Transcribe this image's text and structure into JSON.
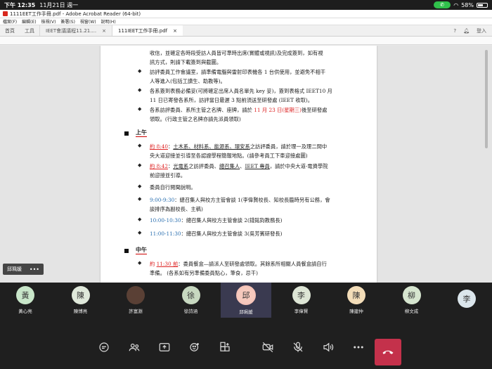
{
  "status_bar": {
    "time": "下午 12:35",
    "date": "11月21日 週一",
    "battery": "58%",
    "battery_level": 0.58
  },
  "window": {
    "title": "1111EET工作手冊.pdf - Adobe Acrobat Reader (64-bit)",
    "menu": [
      "檔案(F)",
      "編輯(E)",
      "檢視(V)",
      "簽署(S)",
      "視窗(W)",
      "說明(H)"
    ],
    "nav": [
      "首頁",
      "工具"
    ],
    "tabs": [
      {
        "label": "IEET會議議程11.21....",
        "close": "×"
      },
      {
        "label": "111IEET工作手冊.pdf",
        "close": "×"
      }
    ],
    "right_actions": {
      "help": "?",
      "login": "登入"
    }
  },
  "document": {
    "top_lines": [
      "收信，並確定各時段受訪人員皆可準時出席(實體或視訊)及完成簽到，如有視",
      "訊方式，則請下載簽到與截圖。"
    ],
    "bullets_top": [
      {
        "lines": [
          "訪評委員工作會議室，請準備電腦與雷射印表機各 1 台供使用，並避免不相干",
          "人等進入(包括工讀生、助教等)。"
        ]
      },
      {
        "lines": [
          "各系簽到表務必備妥(可將確定出席人員名單先 key 妥)，簽到表格式 IEET10 月",
          "11 日已寄發各系所，訪評當日最遲 3 點前須送至研發處 (IEET 收取)。"
        ]
      },
      {
        "pre": "各系訪評委員、系所主管之名牌、座牌，請於 ",
        "red": "11 月 23 日(星期三)",
        "post": "後至研發處",
        "line2": "領取。(行政主管之名牌亦請先派員領取)"
      }
    ],
    "section_morning": "上午",
    "morning_items": [
      {
        "time": "約 8:40",
        "sep": "：",
        "depts": "土木系、材料系、能源系、環安系",
        "rest": "之訪評委員，請於理一及理二間中",
        "line2": "央大道迎接並引導至各認證學程簡報地點。(請參考員工下車迎接處圖)"
      },
      {
        "time": "約 8:42",
        "sep": "：",
        "depts": "光電系",
        "mid": "之訪評委員、",
        "u2": "總召集人",
        "mid2": "、",
        "u3": "IEET 專員",
        "rest": "，請於中央大道-電資學院",
        "line2": "前迎接並引導。"
      },
      {
        "text": "委員自行閱聞說明。"
      },
      {
        "time": "9:00-9:30",
        "rest": "：總召集人與校方主管會談 1(李偉賢校長、知校長臨時另有公務，會",
        "line2": "談排序為副校長、主稿)"
      },
      {
        "time": "10:00-10:30",
        "rest": "：總召集人與校方主管會談 2(錢銘鈞教務長)"
      },
      {
        "time": "11:00-11:30",
        "rest": "：總召集人與校方主管會談 3(吳芳賓研發長)"
      }
    ],
    "section_noon": "中午",
    "noon_item": {
      "pre": "約 ",
      "time": "11:30 前",
      "rest": "：委員餐盒—請派人至研發處領取。其餘系所相關人員餐盒請自行",
      "line2": "準備。 (各系如有另準備委員點心，筆食，忌干)"
    }
  },
  "overlay_name": {
    "label": "邱珮媛",
    "more": "•••"
  },
  "participants": [
    {
      "initial": "黃",
      "name": "黃心亮",
      "color": "#c8e6c9"
    },
    {
      "initial": "陳",
      "name": "陳博亮",
      "color": "#dfe8da"
    },
    {
      "initial": "",
      "name": "許富淵",
      "color": "#5a4035",
      "photo": true
    },
    {
      "initial": "徐",
      "name": "徐詩涵",
      "color": "#c7d8c0"
    },
    {
      "initial": "邱",
      "name": "邱珮媛",
      "color": "#f6c9bd",
      "active": true
    },
    {
      "initial": "李",
      "name": "李偉賢",
      "color": "#dde5d5"
    },
    {
      "initial": "陳",
      "name": "陳建仲",
      "color": "#f3ddb8"
    },
    {
      "initial": "柳",
      "name": "柳文成",
      "color": "#d6e5cf"
    },
    {
      "initial": "李",
      "name": "",
      "color": "#dbe6ec"
    }
  ],
  "controls": [
    "chat-icon",
    "people-icon",
    "share-icon",
    "reactions-icon",
    "apps-icon",
    "camera-off-icon",
    "mic-off-icon",
    "speaker-icon",
    "more-icon",
    "hangup-icon"
  ]
}
